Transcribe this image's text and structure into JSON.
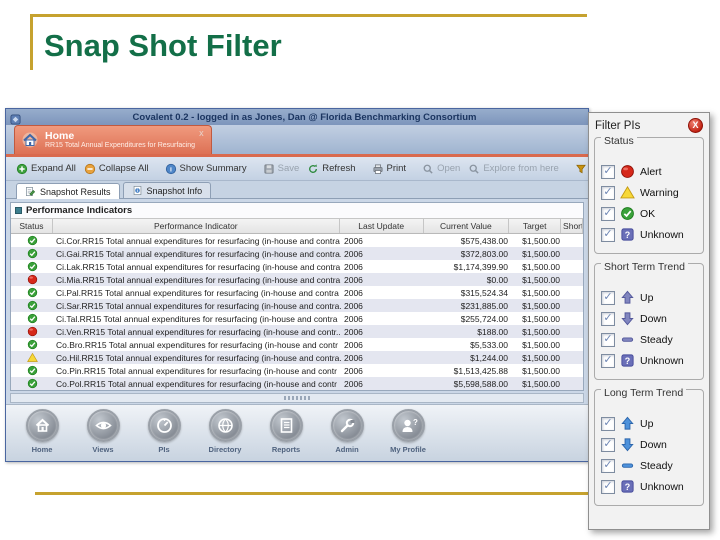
{
  "slide": {
    "title": "Snap Shot Filter",
    "accent_gold": "#C6A22F",
    "title_color": "#136F48"
  },
  "window": {
    "titlebar": "Covalent 0.2 - logged in as Jones, Dan @ Florida Benchmarking Consortium",
    "tab": {
      "title": "Home",
      "subtitle": "RR15 Total Annual Expenditures for Resurfacing",
      "close_glyph": "x"
    },
    "toolbar": [
      {
        "label": "Expand All",
        "icon": "expand-icon",
        "enabled": true,
        "sep_before": false
      },
      {
        "label": "Collapse All",
        "icon": "collapse-icon",
        "enabled": true,
        "sep_before": false
      },
      {
        "label": "Show Summary",
        "icon": "summary-icon",
        "enabled": true,
        "sep_before": true
      },
      {
        "label": "Save",
        "icon": "save-icon",
        "enabled": false,
        "sep_before": true
      },
      {
        "label": "Refresh",
        "icon": "refresh-icon",
        "enabled": true,
        "sep_before": false
      },
      {
        "label": "Print",
        "icon": "print-icon",
        "enabled": true,
        "sep_before": true
      },
      {
        "label": "Open",
        "icon": "open-icon",
        "enabled": false,
        "sep_before": true
      },
      {
        "label": "Explore from here",
        "icon": "explore-icon",
        "enabled": false,
        "sep_before": false
      },
      {
        "label": "Filter PIs",
        "icon": "filter-icon",
        "enabled": true,
        "sep_before": true
      }
    ],
    "subtabs": [
      {
        "label": "Snapshot Results",
        "icon": "results-icon",
        "active": true
      },
      {
        "label": "Snapshot Info",
        "icon": "info-icon",
        "active": false
      }
    ],
    "section_title": "Performance Indicators",
    "table": {
      "headers": [
        "Status",
        "Performance Indicator",
        "Last Update",
        "Current Value",
        "Target",
        "Short Trend"
      ],
      "rows": [
        {
          "status": "ok",
          "indicator": "Ci.Cor.RR15 Total annual expenditures for resurfacing (in-house and contra",
          "last_update": "2006",
          "current_value": "$575,438.00",
          "target": "$1,500.00"
        },
        {
          "status": "ok",
          "indicator": "Ci.Gai.RR15 Total annual expenditures for resurfacing (in-house and contra...",
          "last_update": "2006",
          "current_value": "$372,803.00",
          "target": "$1,500.00"
        },
        {
          "status": "ok",
          "indicator": "Ci.Lak.RR15 Total annual expenditures for resurfacing (in-house and contra",
          "last_update": "2006",
          "current_value": "$1,174,399.90",
          "target": "$1,500.00"
        },
        {
          "status": "alert",
          "indicator": "Ci.Mia.RR15 Total annual expenditures for resurfacing (in-house and contra...",
          "last_update": "2006",
          "current_value": "$0.00",
          "target": "$1,500.00"
        },
        {
          "status": "ok",
          "indicator": "Ci.Pal.RR15 Total annual expenditures for resurfacing (in-house and contra",
          "last_update": "2006",
          "current_value": "$315,524.34",
          "target": "$1,500.00"
        },
        {
          "status": "ok",
          "indicator": "Ci.Sar.RR15 Total annual expenditures for resurfacing (in-house and contra...",
          "last_update": "2006",
          "current_value": "$231,885.00",
          "target": "$1,500.00"
        },
        {
          "status": "ok",
          "indicator": "Ci.Tal.RR15 Total annual expenditures for resurfacing (in-house and contra",
          "last_update": "2006",
          "current_value": "$255,724.00",
          "target": "$1,500.00"
        },
        {
          "status": "alert",
          "indicator": "Ci.Ven.RR15 Total annual expenditures for resurfacing (in-house and contr...",
          "last_update": "2006",
          "current_value": "$188.00",
          "target": "$1,500.00"
        },
        {
          "status": "ok",
          "indicator": "Co.Bro.RR15 Total annual expenditures for resurfacing (in-house and contr",
          "last_update": "2006",
          "current_value": "$5,533.00",
          "target": "$1,500.00"
        },
        {
          "status": "warning",
          "indicator": "Co.Hil.RR15 Total annual expenditures for resurfacing (in-house and contra...",
          "last_update": "2006",
          "current_value": "$1,244.00",
          "target": "$1,500.00"
        },
        {
          "status": "ok",
          "indicator": "Co.Pin.RR15 Total annual expenditures for resurfacing (in-house and contr",
          "last_update": "2006",
          "current_value": "$1,513,425.88",
          "target": "$1,500.00"
        },
        {
          "status": "ok",
          "indicator": "Co.Pol.RR15 Total annual expenditures for resurfacing (in-house and contr",
          "last_update": "2006",
          "current_value": "$5,598,588.00",
          "target": "$1,500.00"
        }
      ]
    },
    "nav": [
      {
        "label": "Home",
        "icon": "home-icon"
      },
      {
        "label": "Views",
        "icon": "views-icon"
      },
      {
        "label": "PIs",
        "icon": "pis-icon"
      },
      {
        "label": "Directory",
        "icon": "directory-icon"
      },
      {
        "label": "Reports",
        "icon": "reports-icon"
      },
      {
        "label": "Admin",
        "icon": "admin-icon"
      },
      {
        "label": "My Profile",
        "icon": "profile-icon"
      }
    ]
  },
  "filter_panel": {
    "title": "Filter PIs",
    "close_glyph": "X",
    "status_colors": {
      "alert": "#D6281A",
      "warning": "#F7D838",
      "ok": "#3AA13A",
      "unknown": "#6A6FB8"
    },
    "groups": [
      {
        "title": "Status",
        "palette": "status",
        "items": [
          {
            "label": "Alert",
            "icon": "alert-icon",
            "checked": true
          },
          {
            "label": "Warning",
            "icon": "warning-icon",
            "checked": true
          },
          {
            "label": "OK",
            "icon": "ok-icon",
            "checked": true
          },
          {
            "label": "Unknown",
            "icon": "unknown-icon",
            "checked": true
          }
        ]
      },
      {
        "title": "Short Term Trend",
        "palette": "purple",
        "items": [
          {
            "label": "Up",
            "icon": "up-icon",
            "checked": true
          },
          {
            "label": "Down",
            "icon": "down-icon",
            "checked": true
          },
          {
            "label": "Steady",
            "icon": "steady-icon",
            "checked": true
          },
          {
            "label": "Unknown",
            "icon": "unknown-icon",
            "checked": true
          }
        ]
      },
      {
        "title": "Long Term Trend",
        "palette": "blue",
        "items": [
          {
            "label": "Up",
            "icon": "up-icon",
            "checked": true
          },
          {
            "label": "Down",
            "icon": "down-icon",
            "checked": true
          },
          {
            "label": "Steady",
            "icon": "steady-icon",
            "checked": true
          },
          {
            "label": "Unknown",
            "icon": "unknown-icon",
            "checked": true
          }
        ]
      }
    ]
  }
}
